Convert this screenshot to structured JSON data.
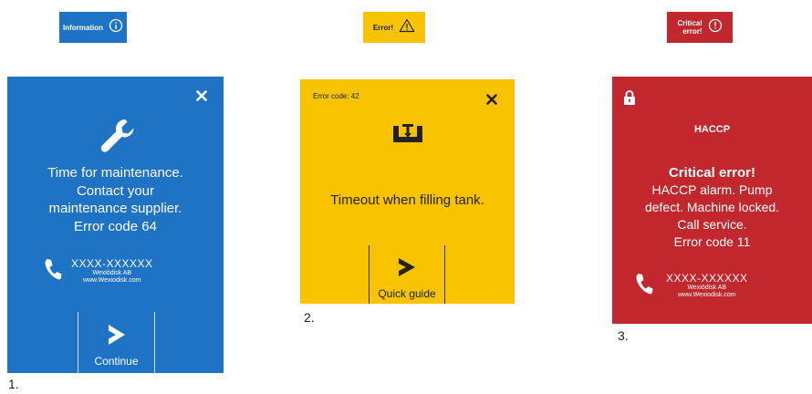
{
  "colors": {
    "info_blue": "#1f73c5",
    "error_yellow": "#f8c300",
    "critical_red": "#c1272d"
  },
  "badges": {
    "information": {
      "label": "Information",
      "icon": "info-circle-icon"
    },
    "error": {
      "label": "Error!",
      "icon": "warning-triangle-icon"
    },
    "critical": {
      "label": "Critical\nerror!",
      "icon": "alert-circle-icon"
    }
  },
  "panels": {
    "info": {
      "close_icon": "close-icon",
      "main_icon": "wrench-icon",
      "message": "Time for maintenance.\nContact your\nmaintenance supplier.\nError code 64",
      "contact": {
        "phone": "XXXX-XXXXXX",
        "company": "Wexiödisk AB",
        "web": "www.Wexiodisk.com"
      },
      "button_label": "Continue",
      "step": "1."
    },
    "error": {
      "error_code": "Error code: 42",
      "close_icon": "close-icon",
      "main_icon": "tank-fill-icon",
      "message": "Timeout when filling tank.",
      "button_label": "Quick guide",
      "step": "2."
    },
    "critical": {
      "lock_icon": "lock-icon",
      "title": "HACCP",
      "message_heading": "Critical error!",
      "message": "HACCP alarm. Pump\ndefect. Machine locked.\nCall service.\nError code 11",
      "contact": {
        "phone": "XXXX-XXXXXX",
        "company": "Wexiödisk AB",
        "web": "www.Wexiodisk.com"
      },
      "step": "3."
    }
  }
}
